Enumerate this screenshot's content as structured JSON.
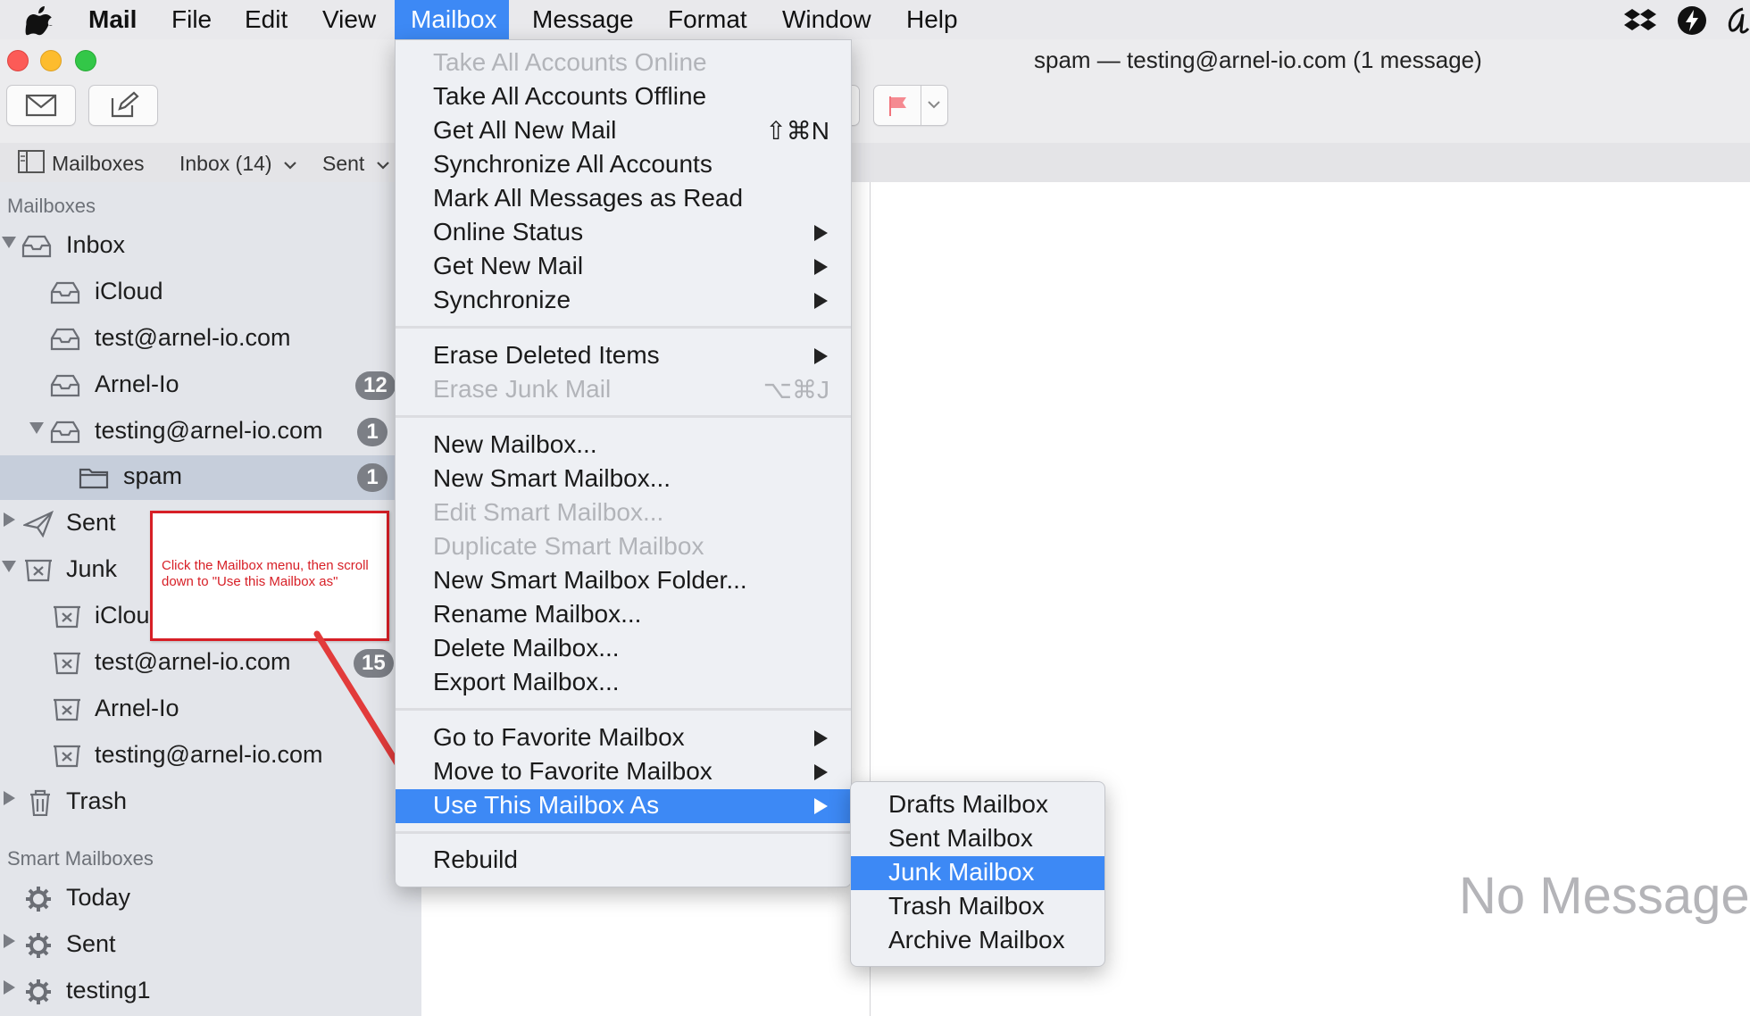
{
  "menubar": {
    "app": "Mail",
    "items": [
      "File",
      "Edit",
      "View",
      "Mailbox",
      "Message",
      "Format",
      "Window",
      "Help"
    ],
    "active": "Mailbox",
    "status_icons": [
      "dropbox-icon",
      "bolt-icon",
      "script-a-icon"
    ]
  },
  "window": {
    "title": "spam — testing@arnel-io.com (1 message)"
  },
  "toolbar": {
    "buttons": [
      "get-mail-icon",
      "compose-icon",
      "flag-icon",
      "chevron-down-icon"
    ]
  },
  "favorites": {
    "mailboxes": "Mailboxes",
    "inbox": "Inbox (14)",
    "sent": "Sent"
  },
  "sidebar": {
    "section_mailboxes": "Mailboxes",
    "section_smart": "Smart Mailboxes",
    "rows": [
      {
        "label": "Inbox",
        "icon": "inbox-icon"
      },
      {
        "label": "iCloud",
        "icon": "inbox-icon"
      },
      {
        "label": "test@arnel-io.com",
        "icon": "inbox-icon"
      },
      {
        "label": "Arnel-Io",
        "icon": "inbox-icon",
        "badge": "12"
      },
      {
        "label": "testing@arnel-io.com",
        "icon": "inbox-icon",
        "badge": "1"
      },
      {
        "label": "spam",
        "icon": "folder-icon",
        "badge": "1"
      },
      {
        "label": "Sent",
        "icon": "paper-plane-icon"
      },
      {
        "label": "Junk",
        "icon": "junk-tray-icon"
      },
      {
        "label": "iClou",
        "icon": "junk-tray-icon"
      },
      {
        "label": "test@arnel-io.com",
        "icon": "junk-tray-icon",
        "badge": "15"
      },
      {
        "label": "Arnel-Io",
        "icon": "junk-tray-icon"
      },
      {
        "label": "testing@arnel-io.com",
        "icon": "junk-tray-icon"
      },
      {
        "label": "Trash",
        "icon": "trash-icon"
      },
      {
        "label": "Today",
        "icon": "gear-icon"
      },
      {
        "label": "Sent",
        "icon": "gear-icon"
      },
      {
        "label": "testing1",
        "icon": "gear-icon"
      }
    ]
  },
  "mailbox_menu": {
    "items": [
      {
        "label": "Take All Accounts Online",
        "disabled": true
      },
      {
        "label": "Take All Accounts Offline"
      },
      {
        "label": "Get All New Mail",
        "shortcut": "⇧⌘N"
      },
      {
        "label": "Synchronize All Accounts"
      },
      {
        "label": "Mark All Messages as Read"
      },
      {
        "label": "Online Status",
        "submenu": true
      },
      {
        "label": "Get New Mail",
        "submenu": true
      },
      {
        "label": "Synchronize",
        "submenu": true
      },
      {
        "label": "Erase Deleted Items",
        "submenu": true
      },
      {
        "label": "Erase Junk Mail",
        "shortcut": "⌥⌘J",
        "disabled": true
      },
      {
        "label": "New Mailbox..."
      },
      {
        "label": "New Smart Mailbox..."
      },
      {
        "label": "Edit Smart Mailbox...",
        "disabled": true
      },
      {
        "label": "Duplicate Smart Mailbox",
        "disabled": true
      },
      {
        "label": "New Smart Mailbox Folder..."
      },
      {
        "label": "Rename Mailbox..."
      },
      {
        "label": "Delete Mailbox..."
      },
      {
        "label": "Export Mailbox..."
      },
      {
        "label": "Go to Favorite Mailbox",
        "submenu": true
      },
      {
        "label": "Move to Favorite Mailbox",
        "submenu": true
      },
      {
        "label": "Use This Mailbox As",
        "submenu": true,
        "highlighted": true
      },
      {
        "label": "Rebuild"
      }
    ]
  },
  "use_as_submenu": {
    "items": [
      {
        "label": "Drafts Mailbox"
      },
      {
        "label": "Sent Mailbox"
      },
      {
        "label": "Junk Mailbox",
        "highlighted": true
      },
      {
        "label": "Trash Mailbox"
      },
      {
        "label": "Archive Mailbox"
      }
    ]
  },
  "callout": {
    "text": "Click the Mailbox menu, then scroll down to \"Use this Mailbox as\""
  },
  "preview": {
    "empty_text": "No Message"
  },
  "colors": {
    "highlight": "#3d89f5",
    "annotation_red": "#d71f26",
    "badge_gray": "#7c7f86",
    "selected_row": "#c6cedb"
  }
}
